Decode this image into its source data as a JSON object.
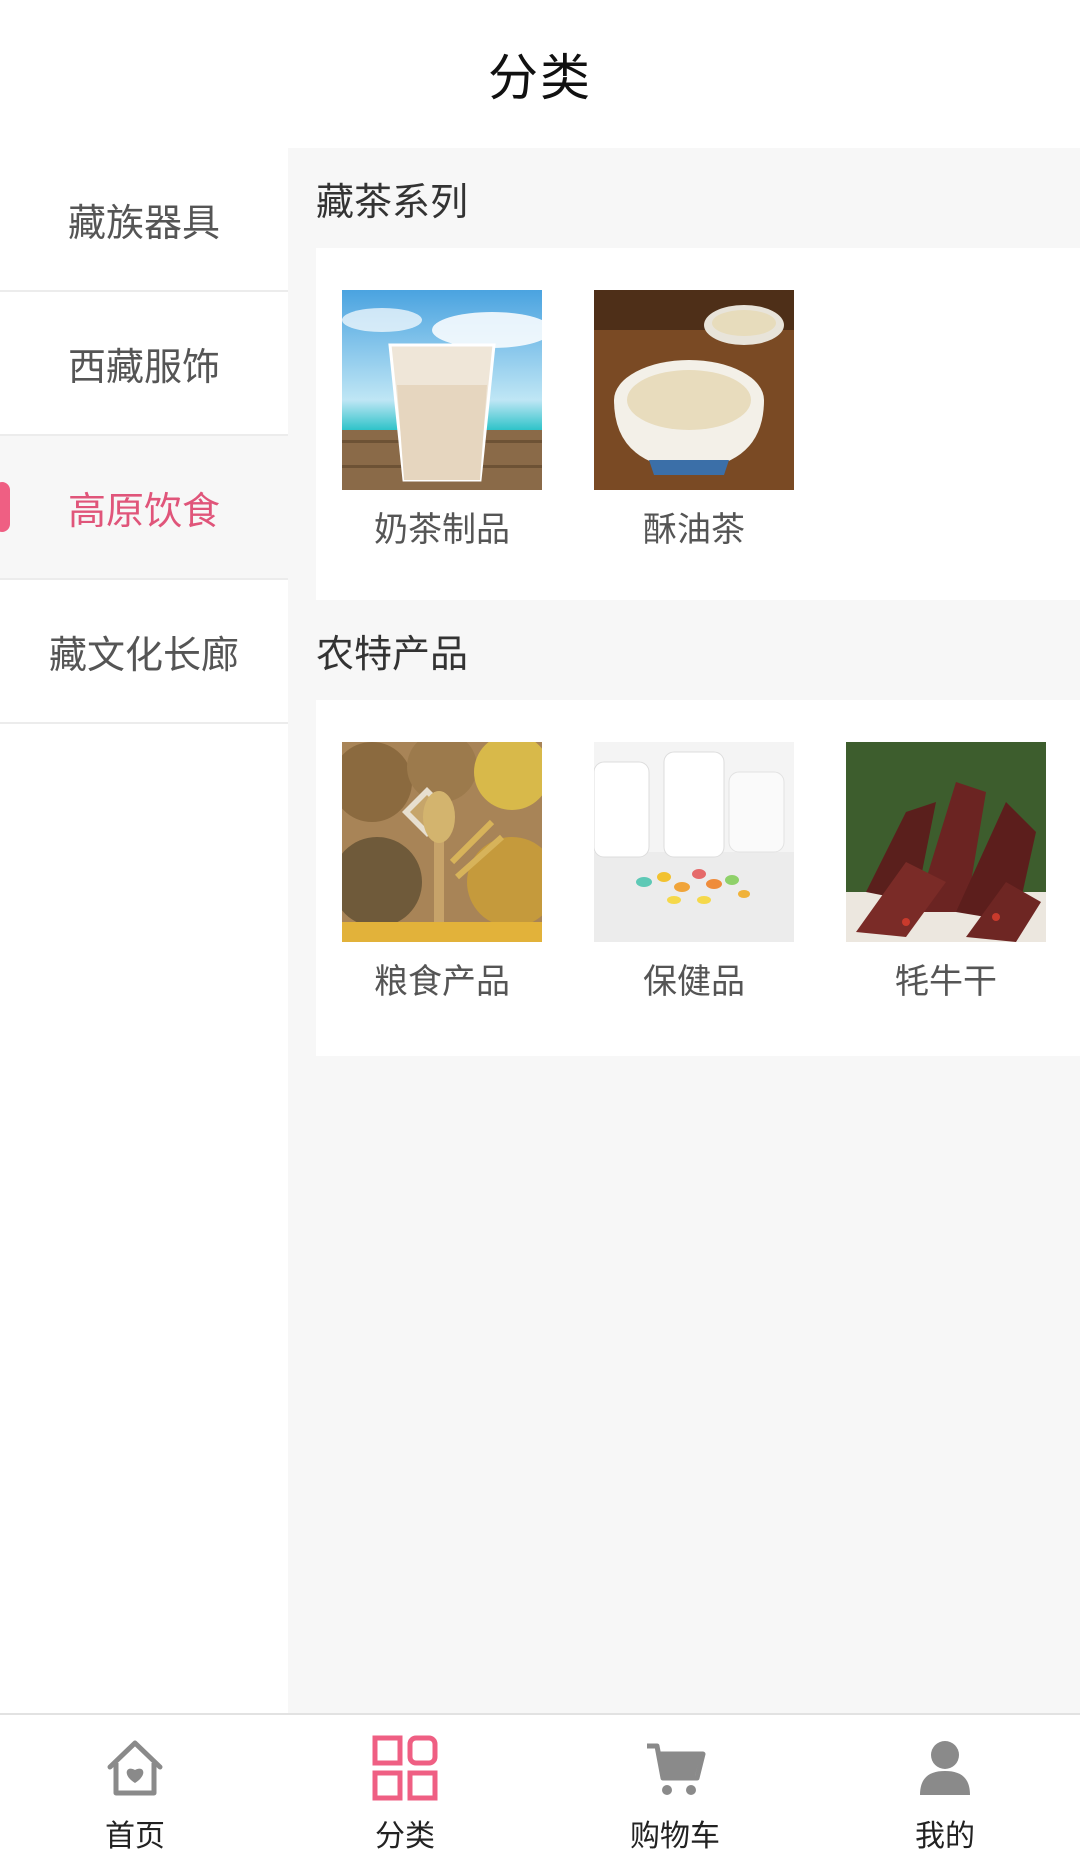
{
  "header": {
    "title": "分类"
  },
  "sidebar": {
    "items": [
      {
        "label": "藏族器具",
        "active": false
      },
      {
        "label": "西藏服饰",
        "active": false
      },
      {
        "label": "高原饮食",
        "active": true
      },
      {
        "label": "藏文化长廊",
        "active": false
      }
    ]
  },
  "sections": [
    {
      "title": "藏茶系列",
      "products": [
        {
          "name": "奶茶制品",
          "image": "milk-tea-image"
        },
        {
          "name": "酥油茶",
          "image": "butter-tea-image"
        }
      ]
    },
    {
      "title": "农特产品",
      "products": [
        {
          "name": "粮食产品",
          "image": "grain-image"
        },
        {
          "name": "保健品",
          "image": "supplement-image"
        },
        {
          "name": "牦牛干",
          "image": "yak-jerky-image"
        }
      ]
    }
  ],
  "tabbar": {
    "tabs": [
      {
        "label": "首页",
        "icon": "home-icon",
        "active": false
      },
      {
        "label": "分类",
        "icon": "category-icon",
        "active": true
      },
      {
        "label": "购物车",
        "icon": "cart-icon",
        "active": false
      },
      {
        "label": "我的",
        "icon": "user-icon",
        "active": false
      }
    ]
  },
  "colors": {
    "accent": "#e0557a",
    "sidebar_active_bg": "#f7f7f7",
    "text": "#555555",
    "icon_gray": "#8a8a8a"
  }
}
